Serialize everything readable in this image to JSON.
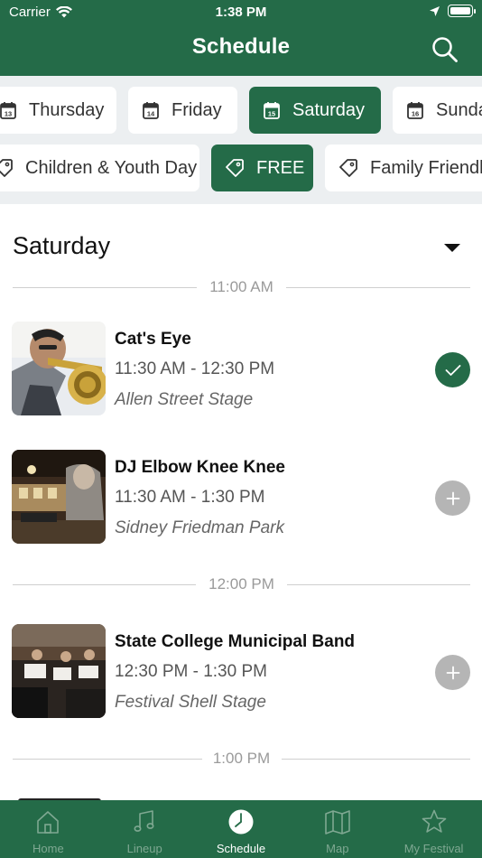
{
  "status_bar": {
    "carrier": "Carrier",
    "time": "1:38 PM"
  },
  "header": {
    "title": "Schedule"
  },
  "day_chips": [
    "Thursday",
    "Friday",
    "Saturday",
    "Sunday"
  ],
  "day_chip_numbers": [
    "13",
    "14",
    "15",
    "16"
  ],
  "tag_chips": [
    "Children & Youth Day",
    "FREE",
    "Family Friendly"
  ],
  "selected_day": "Saturday",
  "selected_tag": "FREE",
  "day_section": {
    "title": "Saturday"
  },
  "time_slots": [
    "11:00 AM",
    "12:00 PM",
    "1:00 PM"
  ],
  "events": [
    {
      "title": "Cat's Eye",
      "time": "11:30 AM - 12:30 PM",
      "venue": "Allen Street Stage",
      "added": true
    },
    {
      "title": "DJ Elbow Knee Knee",
      "time": "11:30 AM - 1:30 PM",
      "venue": "Sidney Friedman Park",
      "added": false
    },
    {
      "title": "State College Municipal Band",
      "time": "12:30 PM - 1:30 PM",
      "venue": "Festival Shell Stage",
      "added": false
    }
  ],
  "tabs": [
    {
      "label": "Home",
      "icon": "home-icon"
    },
    {
      "label": "Lineup",
      "icon": "music-note-icon"
    },
    {
      "label": "Schedule",
      "icon": "clock-icon"
    },
    {
      "label": "Map",
      "icon": "map-icon"
    },
    {
      "label": "My Festival",
      "icon": "star-icon"
    }
  ],
  "active_tab": "Schedule",
  "colors": {
    "brand_green": "#246b48",
    "add_grey": "#b5b5b5",
    "filter_bg": "#eceff1"
  }
}
